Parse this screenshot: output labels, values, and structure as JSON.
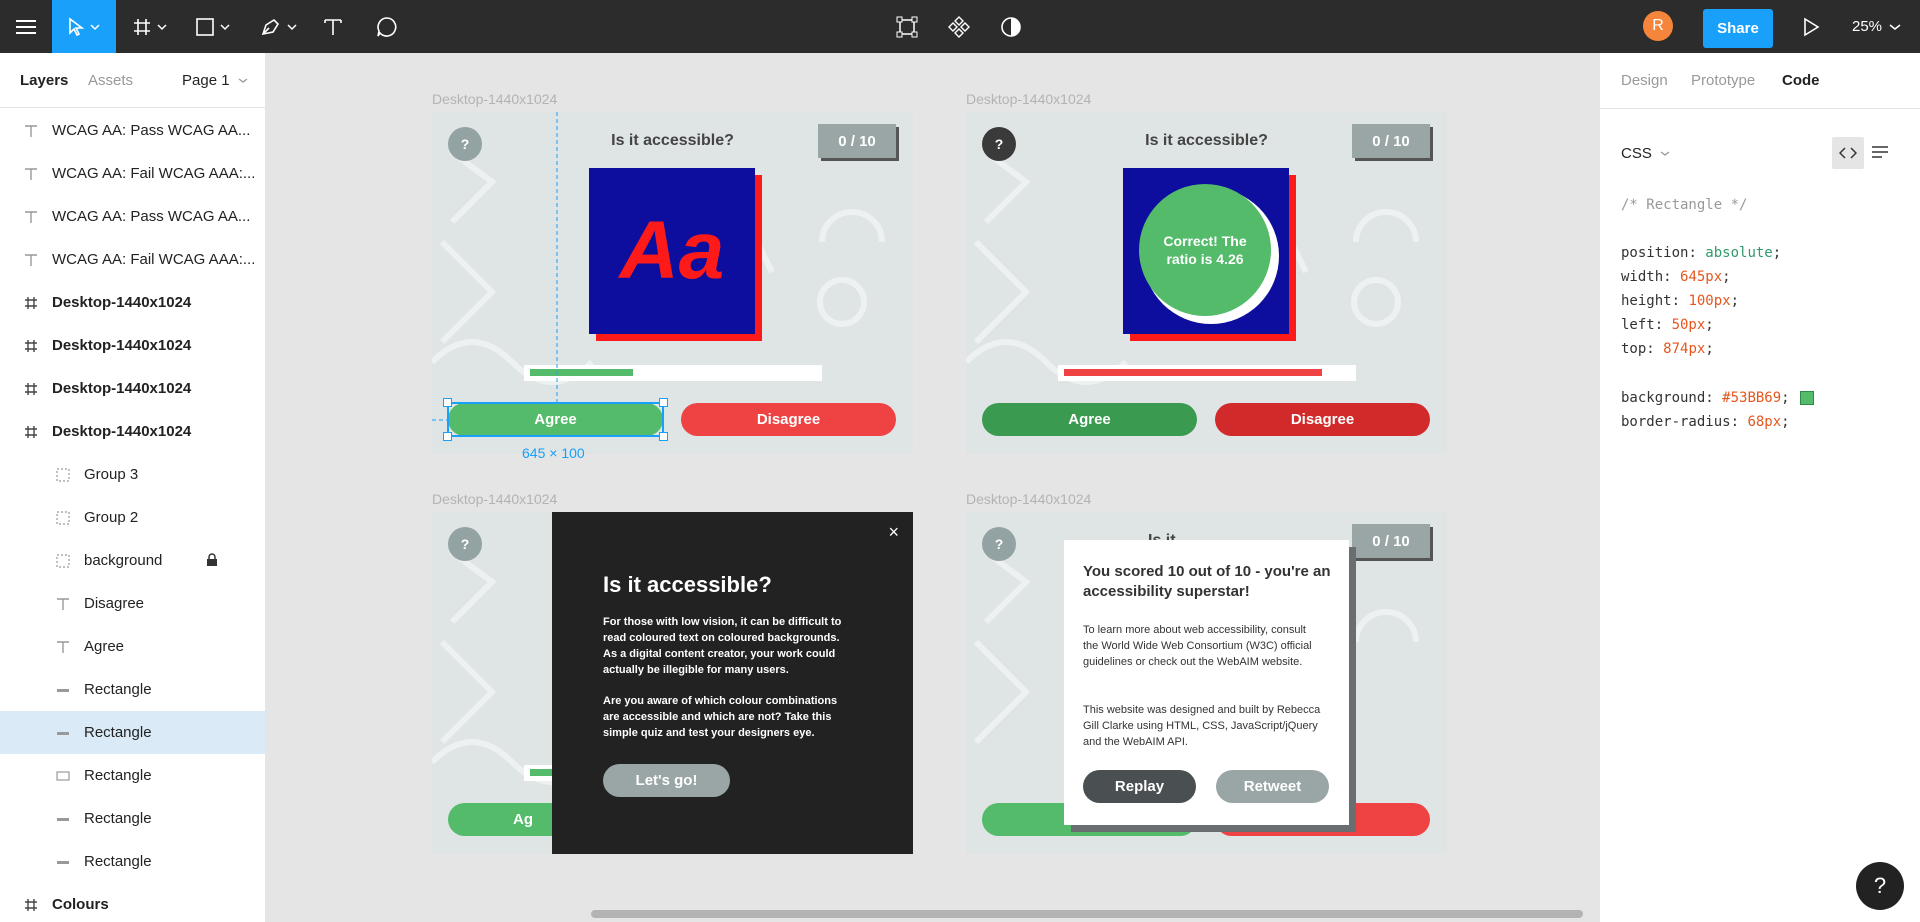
{
  "toolbar": {
    "tools": [
      "menu-icon",
      "move-tool-icon",
      "frame-tool-icon",
      "shape-tool-icon",
      "pen-tool-icon",
      "text-tool-icon",
      "comment-tool-icon"
    ],
    "center_tools": [
      "edit-object-icon",
      "component-icon",
      "mask-icon"
    ],
    "avatar_initial": "R",
    "share_label": "Share",
    "zoom_label": "25%"
  },
  "left_panel": {
    "tabs": [
      "Layers",
      "Assets"
    ],
    "page_label": "Page 1",
    "layers": [
      {
        "icon": "text-layer-icon",
        "label": "WCAG AA: Pass WCAG AA...",
        "bold": false,
        "indent": 0
      },
      {
        "icon": "text-layer-icon",
        "label": "WCAG AA: Fail WCAG AAA:...",
        "bold": false,
        "indent": 0
      },
      {
        "icon": "text-layer-icon",
        "label": "WCAG AA: Pass WCAG AA...",
        "bold": false,
        "indent": 0
      },
      {
        "icon": "text-layer-icon",
        "label": "WCAG AA: Fail WCAG AAA:...",
        "bold": false,
        "indent": 0
      },
      {
        "icon": "frame-layer-icon",
        "label": "Desktop-1440x1024",
        "bold": true,
        "indent": 0
      },
      {
        "icon": "frame-layer-icon",
        "label": "Desktop-1440x1024",
        "bold": true,
        "indent": 0
      },
      {
        "icon": "frame-layer-icon",
        "label": "Desktop-1440x1024",
        "bold": true,
        "indent": 0
      },
      {
        "icon": "frame-layer-icon",
        "label": "Desktop-1440x1024",
        "bold": true,
        "indent": 0
      },
      {
        "icon": "group-layer-icon",
        "label": "Group 3",
        "bold": false,
        "indent": 1
      },
      {
        "icon": "group-layer-icon",
        "label": "Group 2",
        "bold": false,
        "indent": 1
      },
      {
        "icon": "group-layer-icon",
        "label": "background",
        "bold": false,
        "indent": 1,
        "locked": true
      },
      {
        "icon": "text-layer-icon",
        "label": "Disagree",
        "bold": false,
        "indent": 1
      },
      {
        "icon": "text-layer-icon",
        "label": "Agree",
        "bold": false,
        "indent": 1
      },
      {
        "icon": "line-layer-icon",
        "label": "Rectangle",
        "bold": false,
        "indent": 1
      },
      {
        "icon": "line-layer-icon",
        "label": "Rectangle",
        "bold": false,
        "indent": 1,
        "selected": true
      },
      {
        "icon": "rect-layer-icon",
        "label": "Rectangle",
        "bold": false,
        "indent": 1
      },
      {
        "icon": "line-layer-icon",
        "label": "Rectangle",
        "bold": false,
        "indent": 1
      },
      {
        "icon": "line-layer-icon",
        "label": "Rectangle",
        "bold": false,
        "indent": 1
      },
      {
        "icon": "frame-layer-icon",
        "label": "Colours",
        "bold": true,
        "indent": 0
      }
    ]
  },
  "canvas": {
    "frame_label": "Desktop-1440x1024",
    "quiz": {
      "question_mark": "?",
      "title": "Is it accessible?",
      "score": "0 / 10",
      "agree": "Agree",
      "disagree": "Disagree",
      "aa_text": "Aa",
      "correct_text": "Correct! The ratio is 4.26",
      "agree_short": "Ag"
    },
    "selection_size": "645 × 100",
    "intro_modal": {
      "close": "×",
      "title": "Is it accessible?",
      "para1": "For those with low vision, it can be difficult to read coloured text on coloured backgrounds. As a digital content creator, your work could actually be  illegible for many users.",
      "para2": "Are you aware of which colour combinations are accessible and which are not? Take this simple quiz and test your designers eye.",
      "button": "Let's go!"
    },
    "result_modal": {
      "title": "You scored 10 out of 10 - you're an accessibility superstar!",
      "para1": "To learn more about web accessibility, consult the World Wide Web Consortium (W3C) official guidelines or check out the WebAIM website.",
      "para2": "This website was designed and built by Rebecca Gill Clarke using HTML, CSS, JavaScript/jQuery and the WebAIM API.",
      "replay": "Replay",
      "retweet": "Retweet",
      "peek_title": "Is it accessible?"
    }
  },
  "right_panel": {
    "tabs": [
      "Design",
      "Prototype",
      "Code"
    ],
    "active_tab": "Code",
    "language": "CSS",
    "comment": "/* Rectangle */",
    "props": [
      {
        "k": "position",
        "v": "absolute",
        "cls": "g"
      },
      {
        "k": "width",
        "v": "645px",
        "cls": "v"
      },
      {
        "k": "height",
        "v": "100px",
        "cls": "v"
      },
      {
        "k": "left",
        "v": "50px",
        "cls": "v"
      },
      {
        "k": "top",
        "v": "874px",
        "cls": "v"
      }
    ],
    "props2": [
      {
        "k": "background",
        "v": "#53BB69",
        "cls": "v"
      },
      {
        "k": "border-radius",
        "v": "68px",
        "cls": "v"
      }
    ],
    "swatch_color": "#53BB69"
  },
  "help_label": "?",
  "colors": {
    "accent": "#18a0fb",
    "agree_green": "#53bb69",
    "agree_dark": "#3a9a50",
    "disagree_red": "#ef4242",
    "disagree_dark": "#d22a2a",
    "swatch_blue": "#0d0d9e"
  }
}
